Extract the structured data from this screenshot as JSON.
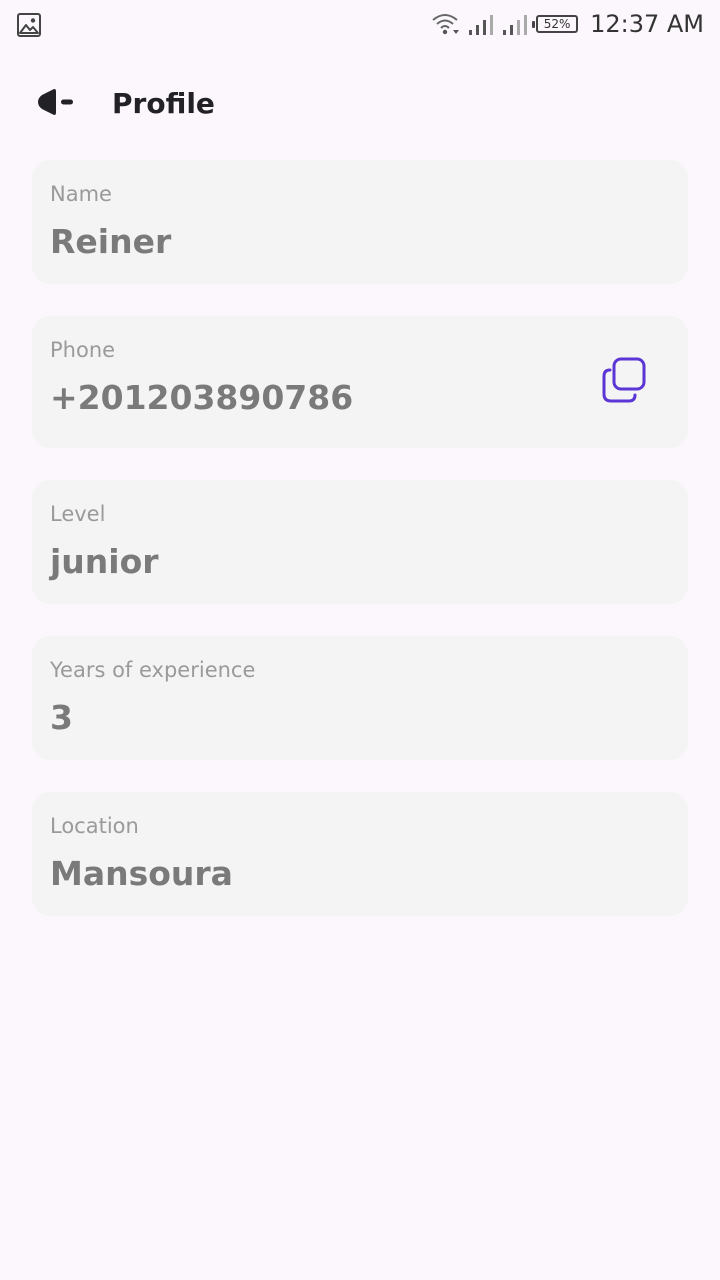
{
  "status_bar": {
    "time": "12:37 AM",
    "battery": "52%",
    "icons": [
      "gallery-icon",
      "wifi-icon",
      "signal-icon",
      "signal-icon"
    ]
  },
  "app_bar": {
    "title": "Profile",
    "back_icon": "back-arrow-icon"
  },
  "fields": {
    "name": {
      "label": "Name",
      "value": "Reiner"
    },
    "phone": {
      "label": "Phone",
      "value": "+201203890786",
      "action_icon": "copy-icon"
    },
    "level": {
      "label": "Level",
      "value": "junior"
    },
    "experience": {
      "label": "Years of experience",
      "value": "3"
    },
    "location": {
      "label": "Location",
      "value": "Mansoura"
    }
  },
  "colors": {
    "background": "#fcf7fd",
    "card": "#f4f4f4",
    "accent": "#5b35d5",
    "label": "#9a9a9a",
    "value": "#7a7a7a"
  }
}
